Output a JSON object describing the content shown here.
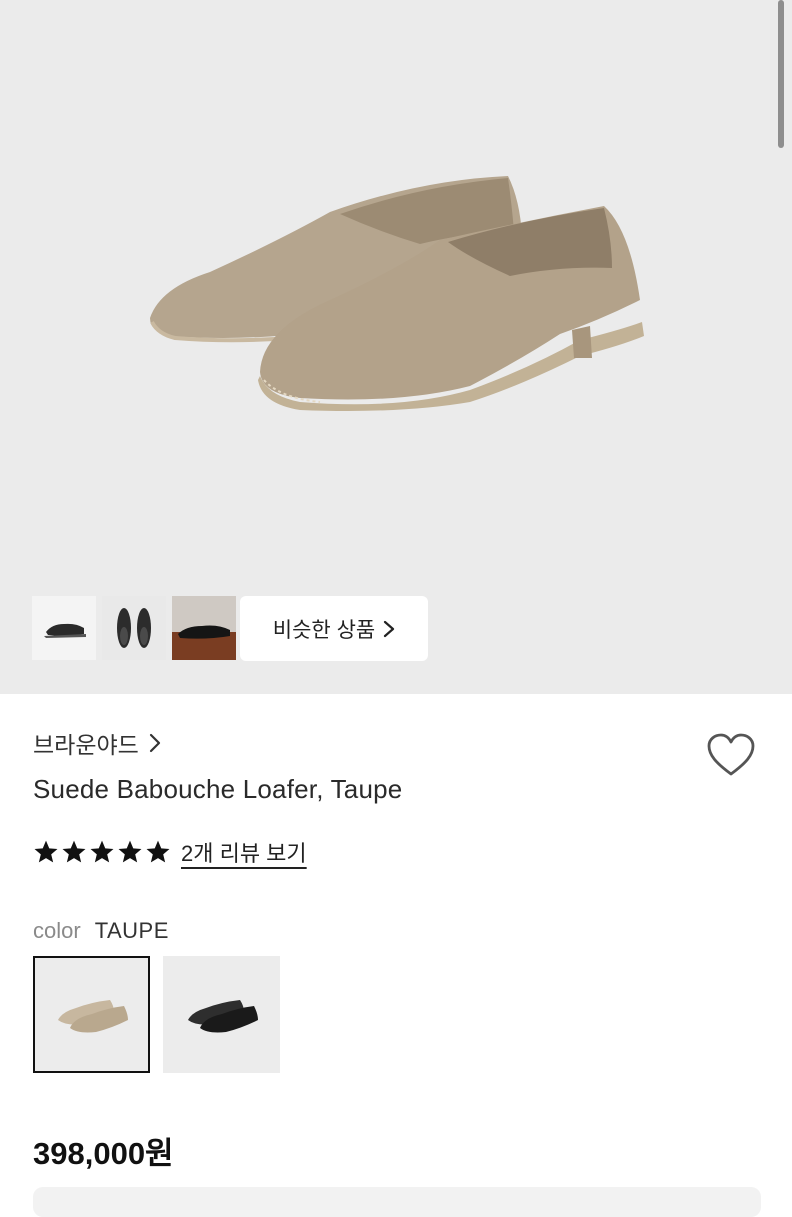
{
  "gallery": {
    "similar_button_label": "비슷한 상품",
    "thumbnails": [
      "thumbnail-black-loafer-side",
      "thumbnail-black-loafers-top",
      "thumbnail-black-loafer-floor"
    ]
  },
  "product": {
    "brand": "브라운야드",
    "name": "Suede Babouche Loafer, Taupe",
    "rating": 5,
    "review_link": "2개 리뷰 보기",
    "color_label": "color",
    "color_value": "TAUPE",
    "swatches": [
      "taupe",
      "black"
    ],
    "price": "398,000원"
  },
  "colors": {
    "hero_bg": "#ebebeb",
    "suede_taupe": "#b3a28a",
    "star": "#111111",
    "selected_border": "#111111"
  }
}
